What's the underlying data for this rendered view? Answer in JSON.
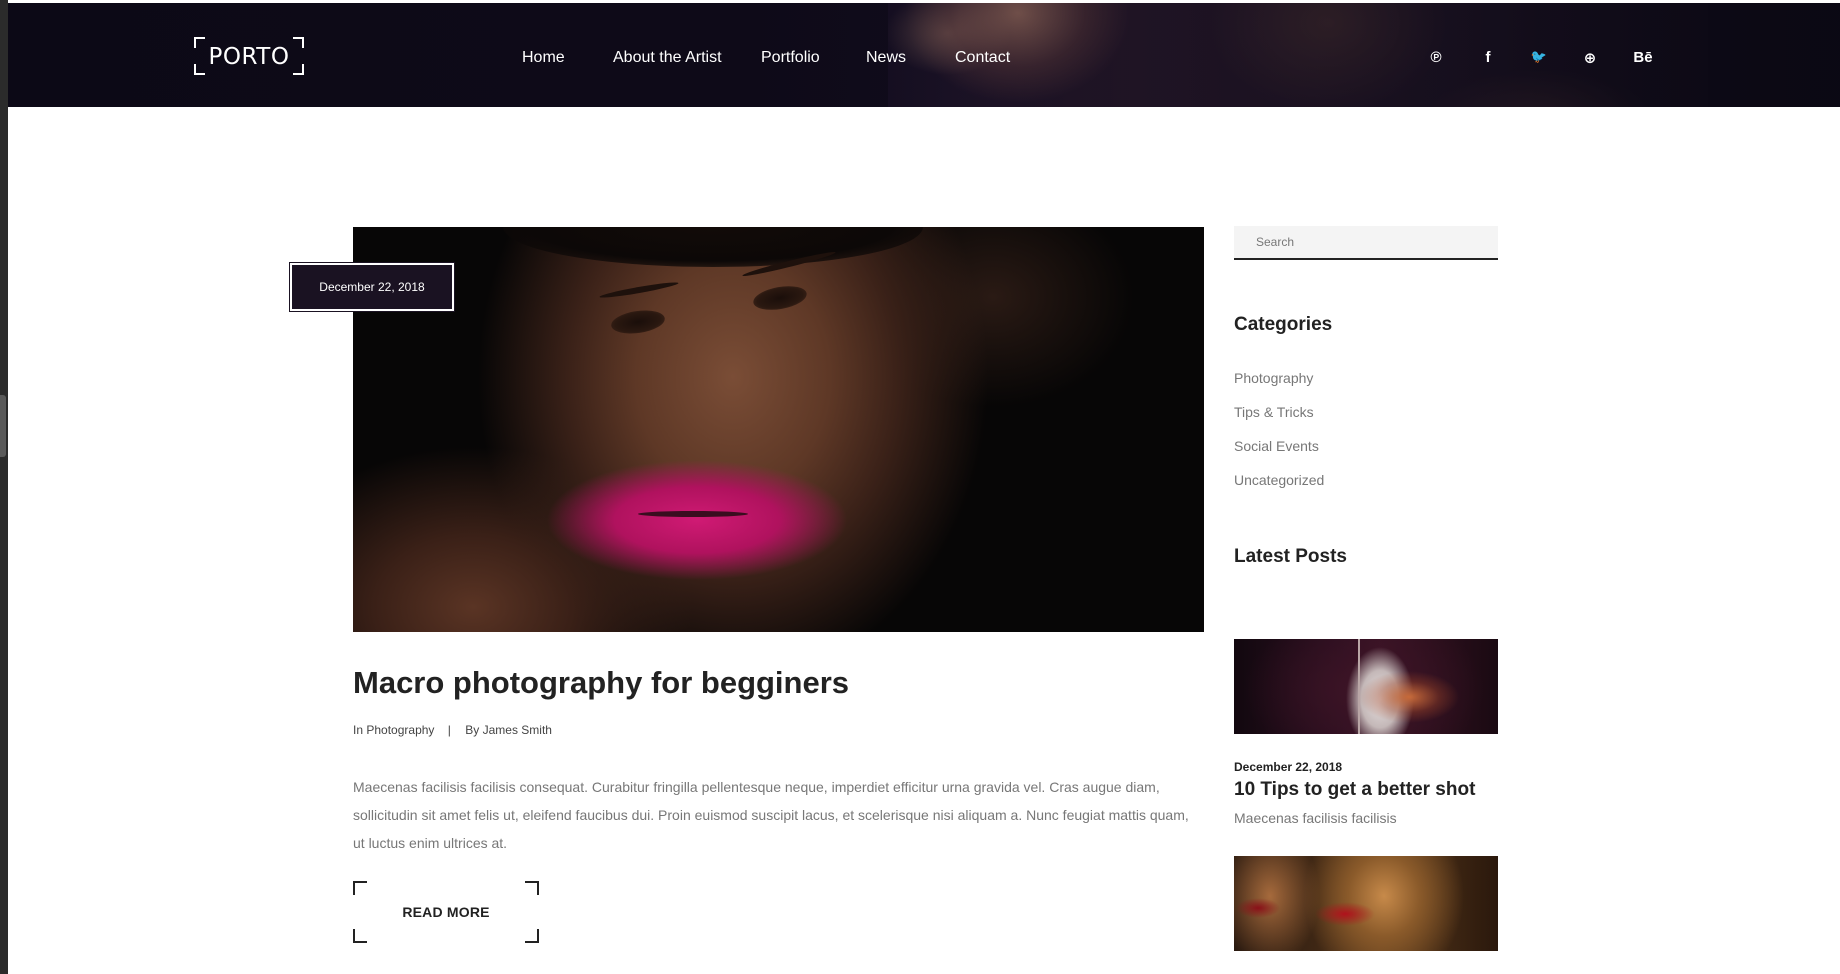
{
  "header": {
    "logo_text": "PORTO",
    "nav": [
      {
        "label": "Home"
      },
      {
        "label": "About the Artist"
      },
      {
        "label": "Portfolio"
      },
      {
        "label": "News"
      },
      {
        "label": "Contact"
      }
    ],
    "social": [
      {
        "icon": "pinterest-icon",
        "glyph": "℗"
      },
      {
        "icon": "facebook-icon",
        "glyph": "f"
      },
      {
        "icon": "twitter-icon",
        "glyph": "🐦"
      },
      {
        "icon": "dribbble-icon",
        "glyph": "⊕"
      },
      {
        "icon": "behance-icon",
        "glyph": "Bē"
      }
    ]
  },
  "post": {
    "date": "December 22, 2018",
    "title": "Macro photography for begginers",
    "category_prefix": "In",
    "category": "Photography",
    "meta_separator": "|",
    "author_prefix": "By",
    "author": "James Smith",
    "excerpt": "Maecenas facilisis facilisis consequat. Curabitur fringilla pellentesque neque, imperdiet efficitur urna gravida vel. Cras augue diam, sollicitudin sit amet felis ut, eleifend faucibus dui. Proin euismod suscipit lacus, et scelerisque nisi aliquam a. Nunc feugiat mattis quam, ut luctus enim ultrices at.",
    "read_more_label": "READ MORE"
  },
  "sidebar": {
    "search_placeholder": "Search",
    "categories_title": "Categories",
    "categories": [
      {
        "label": "Photography"
      },
      {
        "label": "Tips & Tricks"
      },
      {
        "label": "Social Events"
      },
      {
        "label": "Uncategorized"
      }
    ],
    "latest_posts_title": "Latest Posts",
    "latest_posts": [
      {
        "date": "December 22, 2018",
        "title": "10 Tips to get a better shot",
        "excerpt": "Maecenas facilisis facilisis"
      }
    ]
  },
  "colors": {
    "header_bg": "#0f0b1a",
    "date_badge_bg": "#1a1222",
    "text_dark": "#222222",
    "text_muted": "#777777"
  }
}
